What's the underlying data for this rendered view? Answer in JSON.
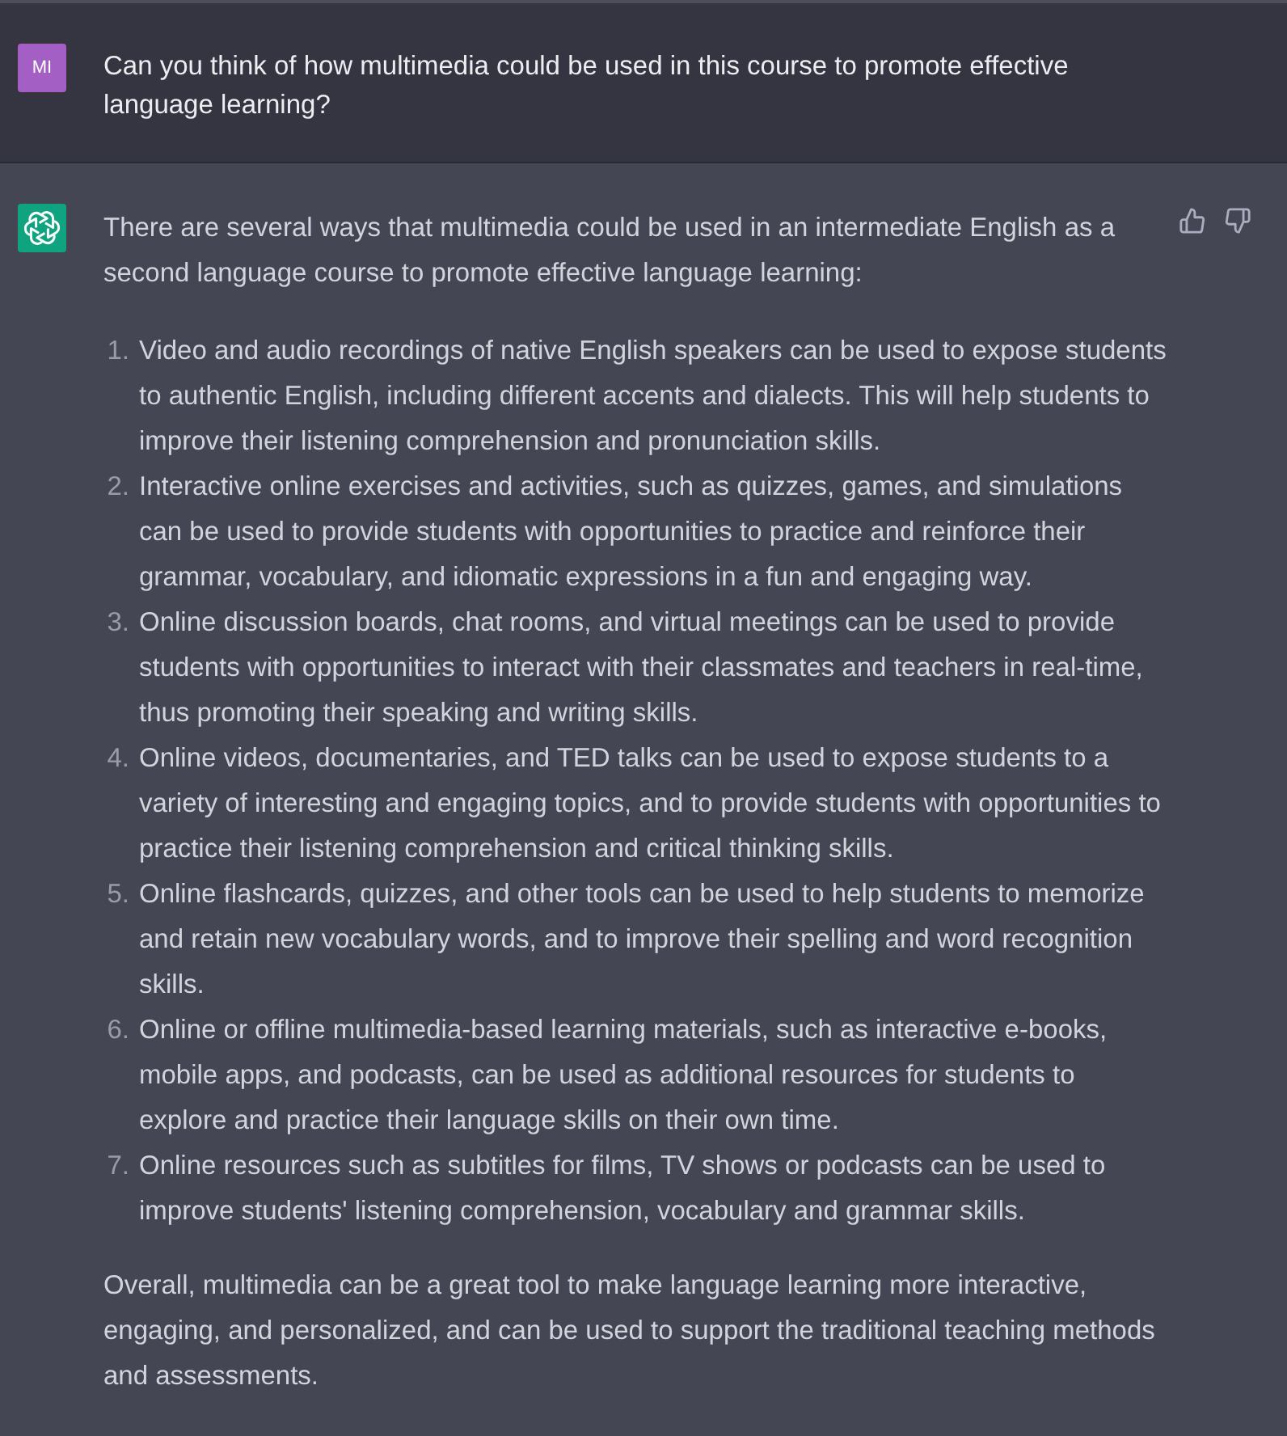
{
  "messages": [
    {
      "kind": "user",
      "avatar": "MI",
      "text": "Can you think of how multimedia could be used in this course to promote effective language learning?"
    },
    {
      "kind": "assistant",
      "intro": "There are several ways that multimedia could be used in an intermediate English as a second language course to promote effective language learning:",
      "items": [
        {
          "number": "1.",
          "text": "Video and audio recordings of native English speakers can be used to expose students to authentic English, including different accents and dialects. This will help students to improve their listening comprehension and pronunciation skills."
        },
        {
          "number": "2.",
          "text": "Interactive online exercises and activities, such as quizzes, games, and simulations can be used to provide students with opportunities to practice and reinforce their grammar, vocabulary, and idiomatic expressions in a fun and engaging way."
        },
        {
          "number": "3.",
          "text": "Online discussion boards, chat rooms, and virtual meetings can be used to provide students with opportunities to interact with their classmates and teachers in real-time, thus promoting their speaking and writing skills."
        },
        {
          "number": "4.",
          "text": "Online videos, documentaries, and TED talks can be used to expose students to a variety of interesting and engaging topics, and to provide students with opportunities to practice their listening comprehension and critical thinking skills."
        },
        {
          "number": "5.",
          "text": "Online flashcards, quizzes, and other tools can be used to help students to memorize and retain new vocabulary words, and to improve their spelling and word recognition skills."
        },
        {
          "number": "6.",
          "text": "Online or offline multimedia-based learning materials, such as interactive e-books, mobile apps, and podcasts, can be used as additional resources for students to explore and practice their language skills on their own time."
        },
        {
          "number": "7.",
          "text": "Online resources such as subtitles for films, TV shows or podcasts can be used to improve students' listening comprehension, vocabulary and grammar skills."
        }
      ],
      "conclusion": "Overall, multimedia can be a great tool to make language learning more interactive, engaging, and personalized, and can be used to support the traditional teaching methods and assessments."
    }
  ]
}
